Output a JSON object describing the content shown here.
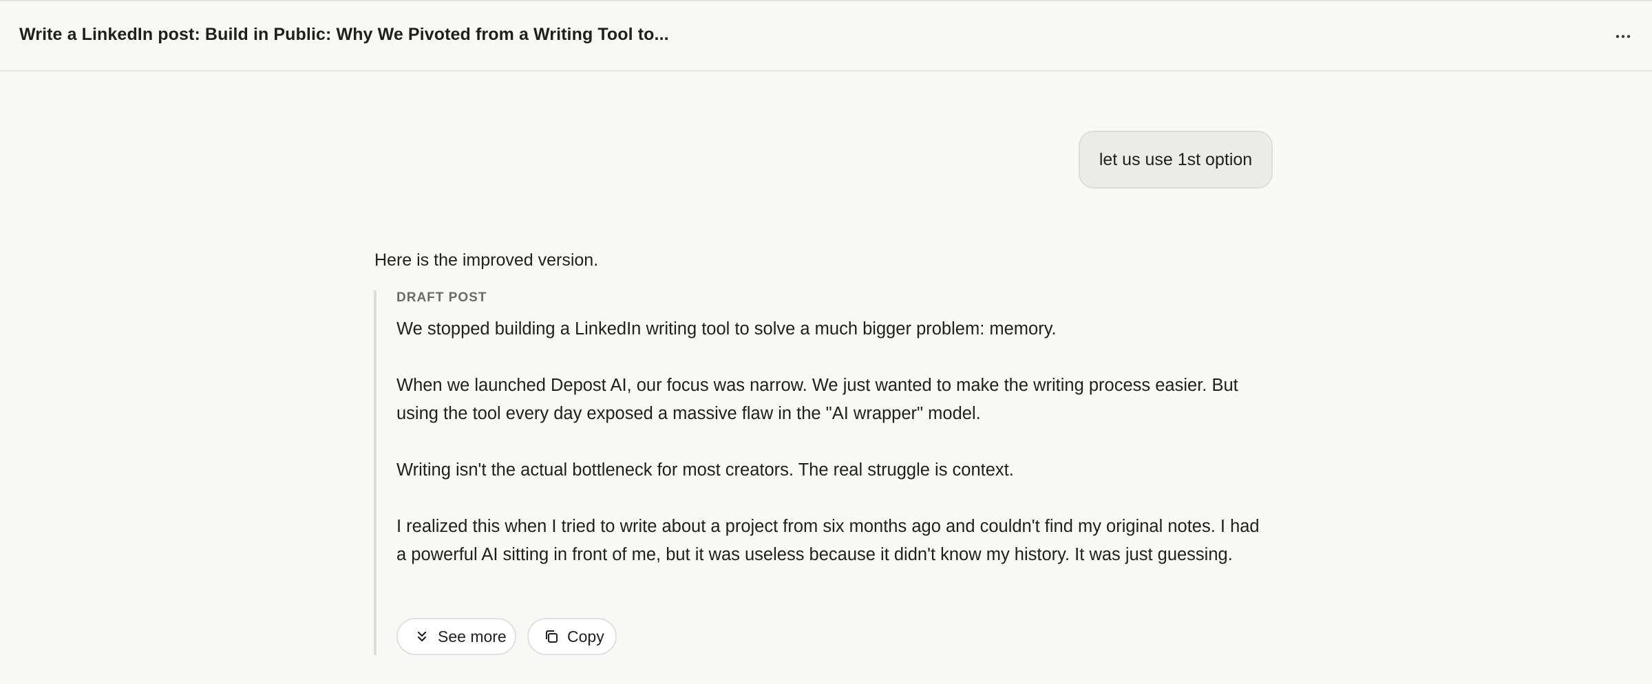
{
  "header": {
    "title": "Write a LinkedIn post: Build in Public: Why We Pivoted from a Writing Tool to...",
    "menu_icon": "more-horizontal-icon"
  },
  "conversation": {
    "user_message": "let us use 1st option",
    "assistant_intro": "Here is the improved version.",
    "draft": {
      "label": "DRAFT POST",
      "paragraphs": [
        "We stopped building a LinkedIn writing tool to solve a much bigger problem: memory.",
        "When we launched Depost AI, our focus was narrow. We just wanted to make the writing process easier. But using the tool every day exposed a massive flaw in the \"AI wrapper\" model.",
        "Writing isn't the actual bottleneck for most creators. The real struggle is context.",
        "I realized this when I tried to write about a project from six months ago and couldn't find my original notes. I had a powerful AI sitting in front of me, but it was useless because it didn't know my history. It was just guessing."
      ],
      "see_more_label": "See more",
      "see_more_icon": "chevrons-down-icon",
      "copy_label": "Copy",
      "copy_icon": "copy-icon"
    }
  },
  "colors": {
    "background": "#f8f8f6",
    "bubble": "#ebebe8",
    "text": "#1f1f1d",
    "muted": "#6a6a66"
  }
}
